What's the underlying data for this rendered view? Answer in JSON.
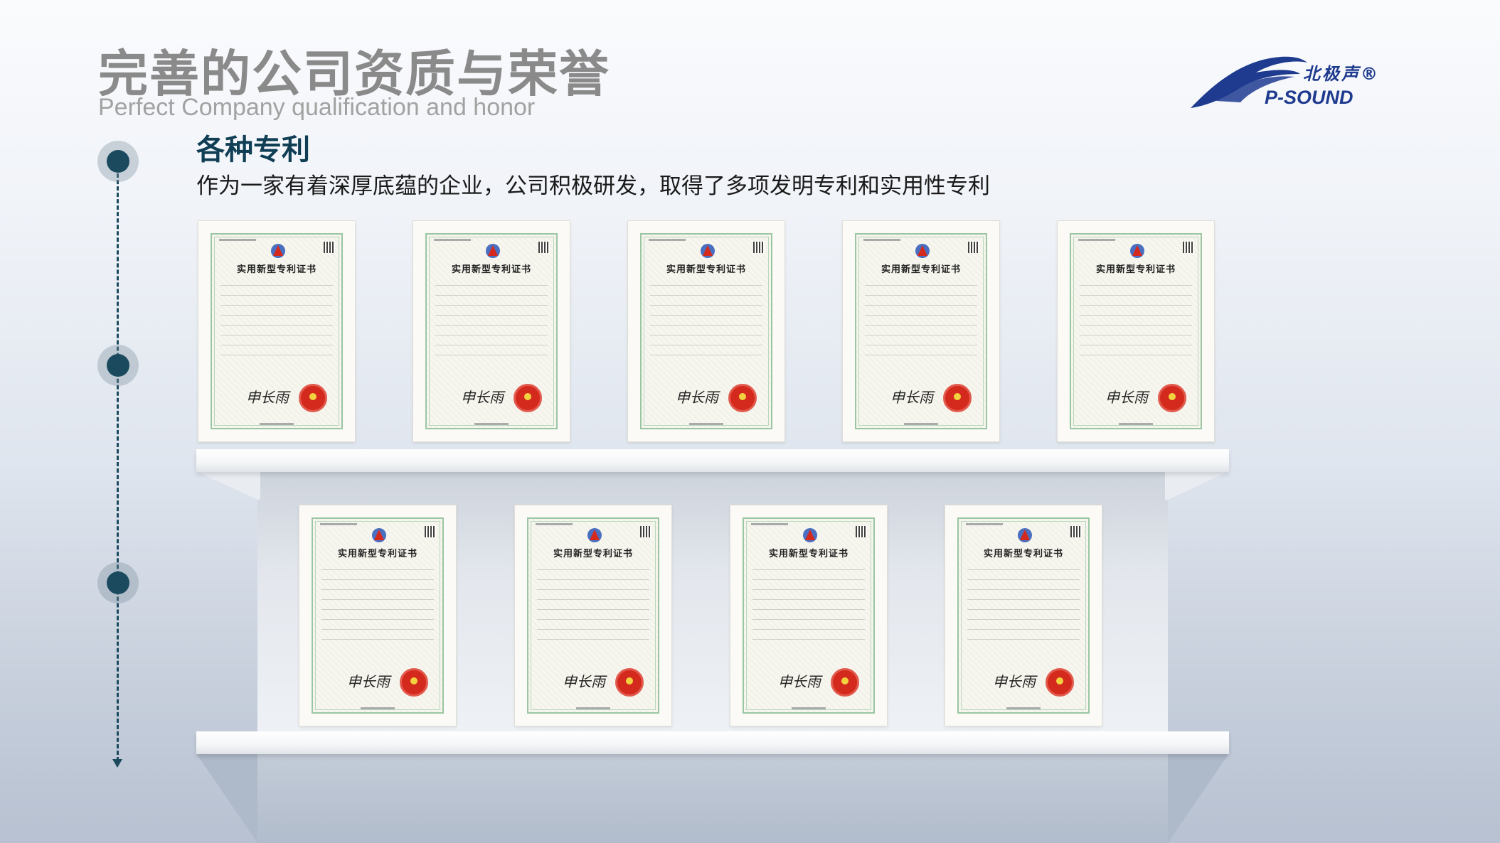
{
  "header": {
    "title_cn": "完善的公司资质与荣誉",
    "title_en": "Perfect Company qualification and honor"
  },
  "logo": {
    "name_cn": "北极声®",
    "name_en": "P-SOUND",
    "color": "#1e3b8f"
  },
  "section": {
    "title": "各种专利",
    "description": "作为一家有着深厚底蕴的企业，公司积极研发，取得了多项发明专利和实用性专利"
  },
  "certificates": {
    "row1": [
      {
        "title": "实用新型专利证书",
        "signature": "申长雨"
      },
      {
        "title": "实用新型专利证书",
        "signature": "申长雨"
      },
      {
        "title": "实用新型专利证书",
        "signature": "申长雨"
      },
      {
        "title": "实用新型专利证书",
        "signature": "申长雨"
      },
      {
        "title": "实用新型专利证书",
        "signature": "申长雨"
      }
    ],
    "row2": [
      {
        "title": "实用新型专利证书",
        "signature": "申长雨"
      },
      {
        "title": "实用新型专利证书",
        "signature": "申长雨"
      },
      {
        "title": "实用新型专利证书",
        "signature": "申长雨"
      },
      {
        "title": "实用新型专利证书",
        "signature": "申长雨"
      }
    ]
  },
  "colors": {
    "accent": "#0f3e55",
    "timeline": "#1b4a5e",
    "title_gray": "#8a8a8a",
    "seal_red": "#d42a1e"
  }
}
